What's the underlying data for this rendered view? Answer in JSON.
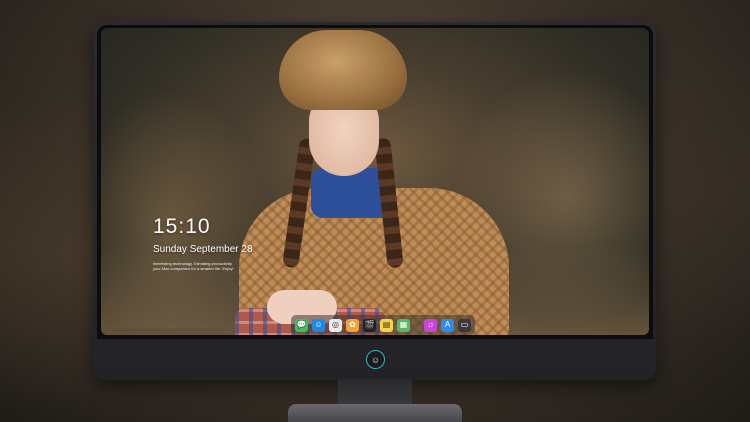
{
  "lockscreen": {
    "time": "15:10",
    "date": "Sunday September 28",
    "tagline": "Interesting technology. Elevating productivity\nyour Mac companion for a smarter life. Enjoy!"
  },
  "dock": {
    "items": [
      {
        "name": "messages-icon",
        "glyph": "💬",
        "color": "#34c759"
      },
      {
        "name": "finder-icon",
        "glyph": "☺",
        "color": "#1e88e5"
      },
      {
        "name": "safari-icon",
        "glyph": "◎",
        "color": "#e9e9ee"
      },
      {
        "name": "photos-icon",
        "glyph": "✿",
        "color": "#f2a33a"
      },
      {
        "name": "clapper-icon",
        "glyph": "🎬",
        "color": "#222222"
      },
      {
        "name": "notes-icon",
        "glyph": "▤",
        "color": "#f5d547"
      },
      {
        "name": "maps-icon",
        "glyph": "▦",
        "color": "#56b86b"
      },
      {
        "name": "music-icon",
        "glyph": "♫",
        "color": "#c845d8"
      },
      {
        "name": "app-store-icon",
        "glyph": "A",
        "color": "#2d8cf0"
      },
      {
        "name": "terminal-icon",
        "glyph": "▭",
        "color": "#3a3a3c"
      }
    ]
  },
  "brand": {
    "accent": "#3fb3b8"
  }
}
